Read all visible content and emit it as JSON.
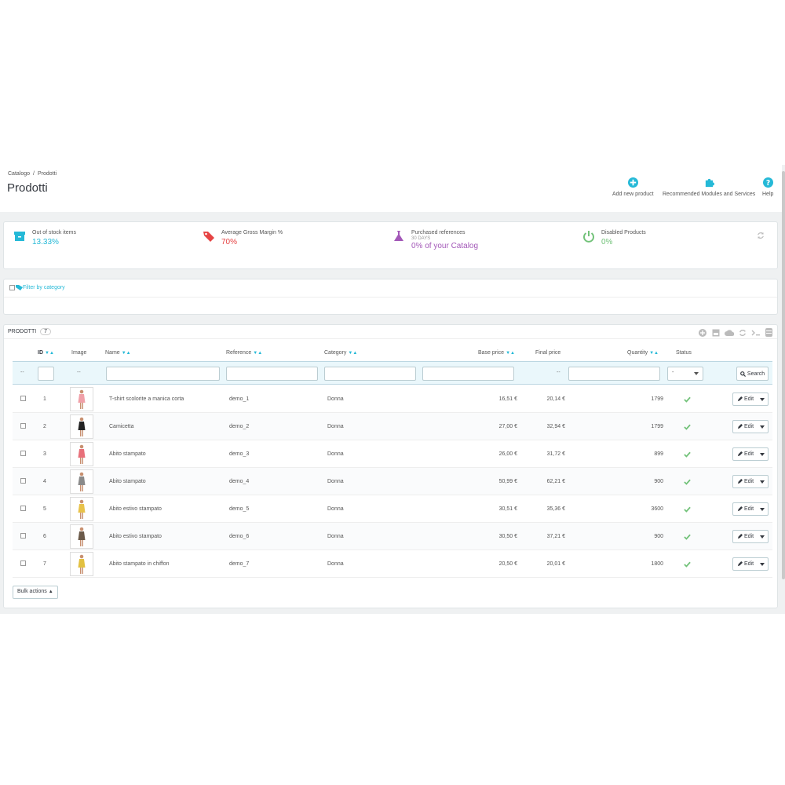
{
  "breadcrumb": {
    "parent": "Catalogo",
    "separator": "/",
    "current": "Prodotti"
  },
  "page_title": "Prodotti",
  "toolbar": {
    "add_label": "Add new product",
    "recommended_label": "Recommended Modules and Services",
    "help_label": "Help"
  },
  "kpis": [
    {
      "label": "Out of stock items",
      "sub": "",
      "value": "13.33%",
      "color": "#25b9d7",
      "icon": "archive-icon"
    },
    {
      "label": "Average Gross Margin %",
      "sub": "",
      "value": "70%",
      "color": "#e64444",
      "icon": "tags-icon"
    },
    {
      "label": "Purchased references",
      "sub": "30 DAYS",
      "value": "0% of your Catalog",
      "color": "#a358b8",
      "icon": "flask-icon"
    },
    {
      "label": "Disabled Products",
      "sub": "",
      "value": "0%",
      "color": "#72c279",
      "icon": "power-icon"
    }
  ],
  "filter_category": {
    "label": "Filter by category"
  },
  "list": {
    "title": "PRODOTTI",
    "count": "7",
    "columns": {
      "id": "ID",
      "image": "Image",
      "name": "Name",
      "reference": "Reference",
      "category": "Category",
      "base_price": "Base price",
      "final_price": "Final price",
      "quantity": "Quantity",
      "status": "Status"
    },
    "filter_dash": "--",
    "status_select": "-",
    "search_label": "Search",
    "edit_label": "Edit",
    "bulk_label": "Bulk actions"
  },
  "rows": [
    {
      "id": "1",
      "name": "T-shirt scolorite a manica corta",
      "reference": "demo_1",
      "category": "Donna",
      "base_price": "16,51 €",
      "final_price": "20,14 €",
      "quantity": "1799",
      "dress": "#f0a0a8"
    },
    {
      "id": "2",
      "name": "Camicetta",
      "reference": "demo_2",
      "category": "Donna",
      "base_price": "27,00 €",
      "final_price": "32,94 €",
      "quantity": "1799",
      "dress": "#222222"
    },
    {
      "id": "3",
      "name": "Abito stampato",
      "reference": "demo_3",
      "category": "Donna",
      "base_price": "26,00 €",
      "final_price": "31,72 €",
      "quantity": "899",
      "dress": "#e8707a"
    },
    {
      "id": "4",
      "name": "Abito stampato",
      "reference": "demo_4",
      "category": "Donna",
      "base_price": "50,99 €",
      "final_price": "62,21 €",
      "quantity": "900",
      "dress": "#8a8a8a"
    },
    {
      "id": "5",
      "name": "Abito estivo stampato",
      "reference": "demo_5",
      "category": "Donna",
      "base_price": "30,51 €",
      "final_price": "35,36 €",
      "quantity": "3600",
      "dress": "#e8c24a"
    },
    {
      "id": "6",
      "name": "Abito estivo stampato",
      "reference": "demo_6",
      "category": "Donna",
      "base_price": "30,50 €",
      "final_price": "37,21 €",
      "quantity": "900",
      "dress": "#6b5a4a"
    },
    {
      "id": "7",
      "name": "Abito stampato in chiffon",
      "reference": "demo_7",
      "category": "Donna",
      "base_price": "20,50 €",
      "final_price": "20,01 €",
      "quantity": "1800",
      "dress": "#e2c040"
    }
  ]
}
